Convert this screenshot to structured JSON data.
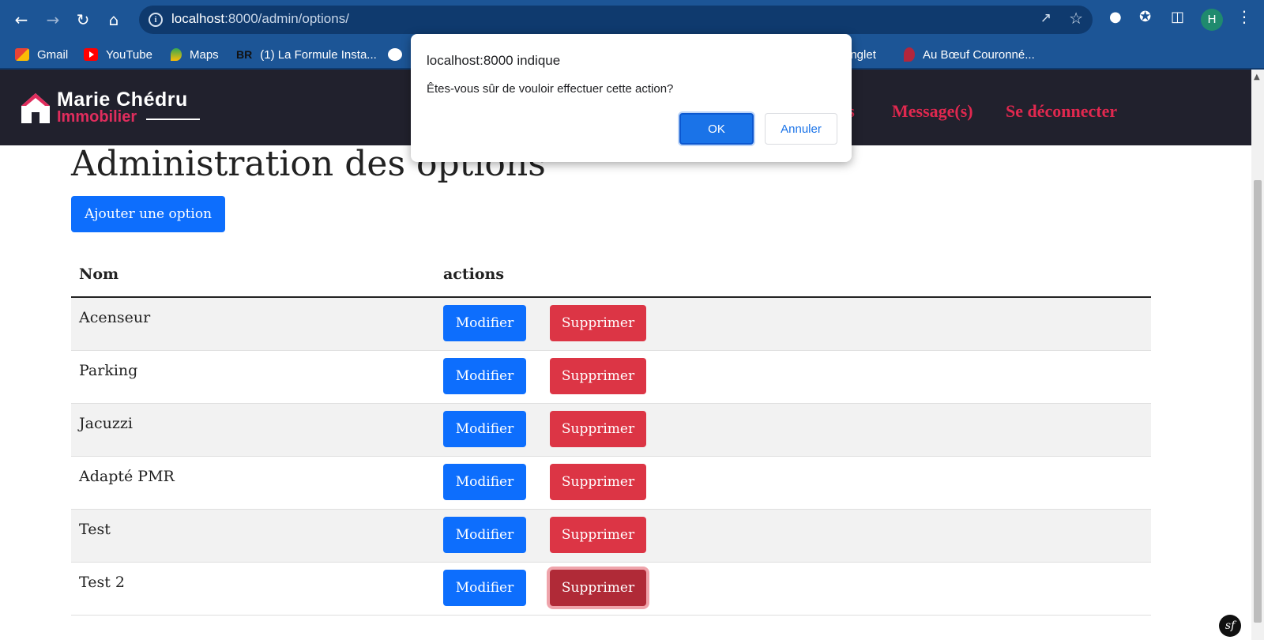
{
  "browser": {
    "url_host": "localhost",
    "url_rest": ":8000/admin/options/",
    "avatar_initial": "H",
    "bookmarks": [
      {
        "label": "Gmail",
        "icon": "gmail-icon"
      },
      {
        "label": "YouTube",
        "icon": "youtube-icon"
      },
      {
        "label": "Maps",
        "icon": "maps-icon"
      },
      {
        "label": "(1) La Formule Insta...",
        "icon": "br-icon",
        "icon_text": "BR"
      },
      {
        "label": "",
        "icon": "globe-icon"
      },
      {
        "label": "onglet",
        "icon": "none"
      },
      {
        "label": "Au Bœuf Couronné...",
        "icon": "pin-icon"
      }
    ]
  },
  "site": {
    "logo_name": "Marie Chédru",
    "logo_sub": "Immobilier",
    "nav": {
      "partial": "ns",
      "messages": "Message(s)",
      "logout": "Se déconnecter"
    }
  },
  "page": {
    "title": "Administration des options",
    "add_button": "Ajouter une option",
    "table": {
      "headers": [
        "Nom",
        "actions"
      ],
      "rows": [
        {
          "name": "Acenseur"
        },
        {
          "name": "Parking"
        },
        {
          "name": "Jacuzzi"
        },
        {
          "name": "Adapté PMR"
        },
        {
          "name": "Test"
        },
        {
          "name": "Test 2"
        }
      ],
      "edit_label": "Modifier",
      "delete_label": "Supprimer"
    }
  },
  "dialog": {
    "title": "localhost:8000 indique",
    "message": "Êtes-vous sûr de vouloir effectuer cette action?",
    "ok": "OK",
    "cancel": "Annuler"
  },
  "colors": {
    "chrome": "#1c5596",
    "header_bg": "#21212d",
    "brand_pink": "#e0284f",
    "primary": "#0d6efd",
    "danger": "#dc3545"
  },
  "symfony_badge": "sf"
}
